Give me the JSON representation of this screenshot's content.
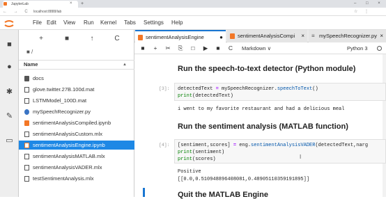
{
  "browser": {
    "tab_title": "JupyterLab",
    "url": "localhost:8888/lab",
    "nav": "← → C",
    "new_tab": "+",
    "tab_close": "×",
    "window_controls": "– □ ×",
    "addr_icons": "☆ ⋮"
  },
  "menubar": {
    "items": [
      "File",
      "Edit",
      "View",
      "Run",
      "Kernel",
      "Tabs",
      "Settings",
      "Help"
    ]
  },
  "filebrowser": {
    "toolbar": [
      "+",
      "■",
      "↑",
      "C"
    ],
    "breadcrumb": "■ /",
    "column_name": "Name",
    "sort_caret": "▲",
    "files": [
      {
        "name": "docs",
        "type": "folder"
      },
      {
        "name": "glove.twitter.27B.100d.mat",
        "type": "file"
      },
      {
        "name": "LSTMModel_100D.mat",
        "type": "file"
      },
      {
        "name": "mySpeechRecognizer.py",
        "type": "python"
      },
      {
        "name": "sentimentAnalysisCompiled.ipynb",
        "type": "notebook"
      },
      {
        "name": "sentimentAnalysisCustom.mlx",
        "type": "file"
      },
      {
        "name": "sentimentAnalysisEngine.ipynb",
        "type": "notebook",
        "selected": true
      },
      {
        "name": "sentimentAnalysisMATLAB.mlx",
        "type": "file"
      },
      {
        "name": "sentimentAnalysisVADER.mlx",
        "type": "file"
      },
      {
        "name": "testSentimentAnalysis.mlx",
        "type": "file"
      }
    ]
  },
  "notebook_tabs": [
    {
      "label": "sentimentAnalysisEngine",
      "marker": "●",
      "active": true
    },
    {
      "label": "sentimentAnalysisCompi",
      "marker": "×"
    },
    {
      "label": "mySpeechRecognizer.py",
      "marker": "×"
    }
  ],
  "toolbar": {
    "buttons": [
      "■",
      "+",
      "✂",
      "⎘",
      "□",
      "▶",
      "■",
      "C"
    ],
    "cell_type": "Markdown ∨",
    "kernel": "Python 3"
  },
  "cells": {
    "heading1": "Run the speech-to-text detector (Python module)",
    "prompt3": "[3]:",
    "code3_line1_var": "detectedText",
    "code3_line1_eq": " = ",
    "code3_line1_rest": "mySpeechRecognizer.",
    "code3_line1_fn": "speechToText",
    "code3_line1_end": "()",
    "code3_line2_bi": "print",
    "code3_line2_rest": "(detectedText)",
    "output3": "i went to my favorite restaurant and had a delicious meal",
    "heading2": "Run the sentiment analysis (MATLAB function)",
    "prompt4": "[4]:",
    "code4_line1_var": "[sentiment,scores]",
    "code4_line1_eq": " = ",
    "code4_line1_rest": "eng.",
    "code4_line1_fn": "sentimentAnalysisVADER",
    "code4_line1_end": "(detectedText,narg",
    "code4_line2_bi": "print",
    "code4_line2_rest": "(sentiment)",
    "code4_line3_bi": "print",
    "code4_line3_rest": "(scores)",
    "output4_line1": "Positive",
    "output4_line2": "[[0.0,0.510948896408081,0.48905110359191895]]",
    "heading3": "Quit the MATLAB Engine"
  },
  "colors": {
    "accent": "#1976d2",
    "jupyter_orange": "#f37726",
    "selected_row": "#1e88e5"
  }
}
